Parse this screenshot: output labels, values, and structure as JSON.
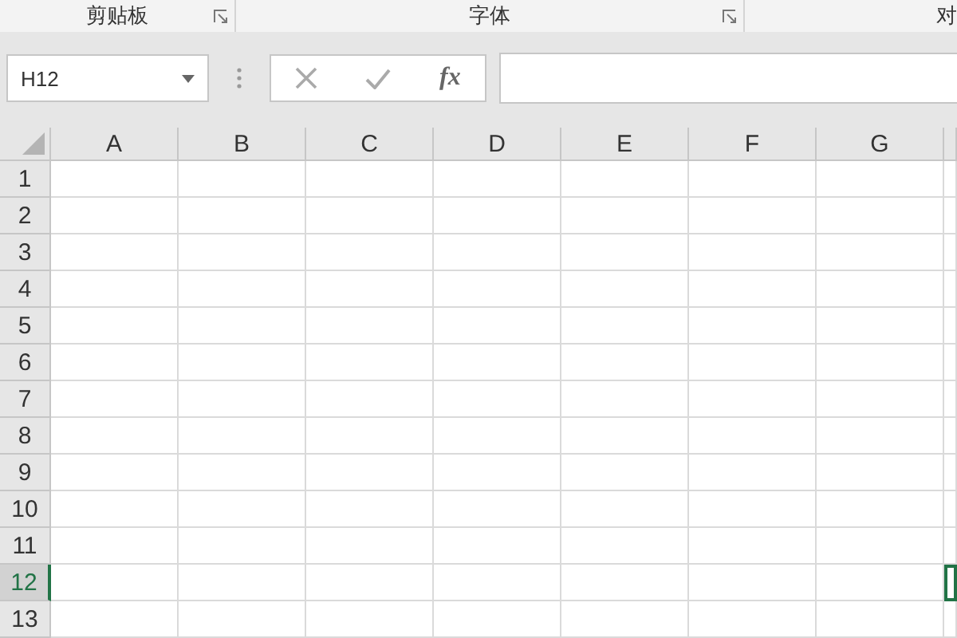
{
  "ribbon_groups": [
    {
      "label": "剪贴板",
      "launcher": true
    },
    {
      "label": "字体",
      "launcher": true
    },
    {
      "label": "对",
      "launcher": false
    }
  ],
  "name_box": {
    "value": "H12"
  },
  "formula_buttons": [
    {
      "kind": "cancel"
    },
    {
      "kind": "enter"
    },
    {
      "kind": "function",
      "label": "fx"
    }
  ],
  "columns": [
    {
      "label": "A",
      "selected": false
    },
    {
      "label": "B",
      "selected": false
    },
    {
      "label": "C",
      "selected": false
    },
    {
      "label": "D",
      "selected": false
    },
    {
      "label": "E",
      "selected": false
    },
    {
      "label": "F",
      "selected": false
    },
    {
      "label": "G",
      "selected": false
    }
  ],
  "rows": [
    {
      "label": "1",
      "selected": false
    },
    {
      "label": "2",
      "selected": false
    },
    {
      "label": "3",
      "selected": false
    },
    {
      "label": "4",
      "selected": false
    },
    {
      "label": "5",
      "selected": false
    },
    {
      "label": "6",
      "selected": false
    },
    {
      "label": "7",
      "selected": false
    },
    {
      "label": "8",
      "selected": false
    },
    {
      "label": "9",
      "selected": false
    },
    {
      "label": "10",
      "selected": false
    },
    {
      "label": "11",
      "selected": false
    },
    {
      "label": "12",
      "selected": true
    },
    {
      "label": "13",
      "selected": false
    }
  ]
}
